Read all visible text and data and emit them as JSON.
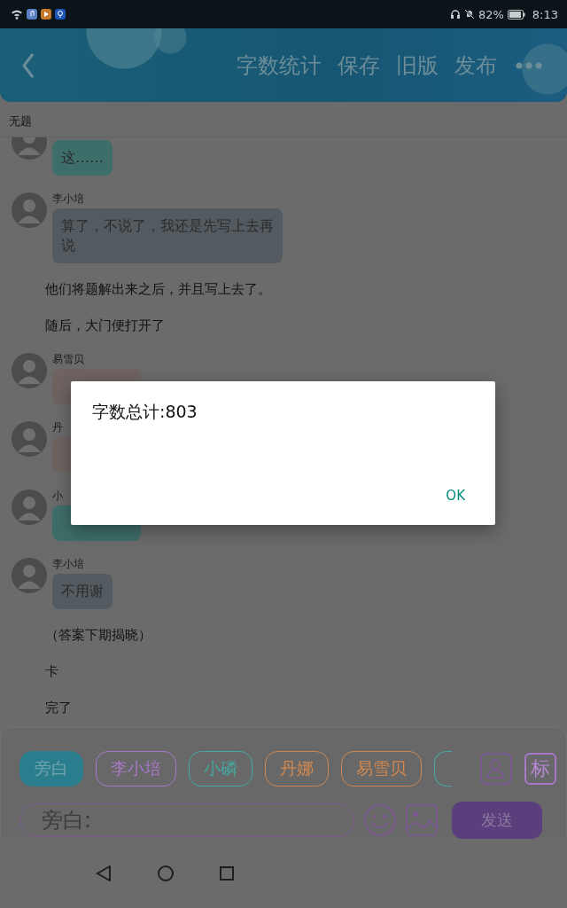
{
  "status_bar": {
    "battery_text": "82%",
    "time": "8:13"
  },
  "header": {
    "actions": [
      "字数统计",
      "保存",
      "旧版",
      "发布"
    ]
  },
  "title": "无题",
  "messages": [
    {
      "kind": "bubble",
      "cut_top": true,
      "text": "这……",
      "color": "#3e6e69"
    },
    {
      "kind": "bubble",
      "speaker": "李小培",
      "text": "算了，不说了，我还是先写上去再说",
      "color": "#545b60"
    },
    {
      "kind": "narration",
      "text": "他们将题解出来之后，并且写上去了。"
    },
    {
      "kind": "narration",
      "text": "随后，大门便打开了"
    },
    {
      "kind": "bubble",
      "speaker": "易雪贝",
      "color": "#6e6361"
    },
    {
      "kind": "bubble",
      "speaker": "丹",
      "color": "#6e6361"
    },
    {
      "kind": "bubble",
      "speaker": "小",
      "color": "#3e6e69"
    },
    {
      "kind": "bubble",
      "speaker": "李小培",
      "text": "不用谢",
      "color": "#545b60"
    },
    {
      "kind": "narration",
      "text": "（答案下期揭晓）"
    },
    {
      "kind": "narration",
      "text": "卡"
    },
    {
      "kind": "narration",
      "text": "完了"
    }
  ],
  "dialog": {
    "message": "字数总计:803",
    "button": "OK"
  },
  "input_panel": {
    "chips": [
      {
        "kind": "chip",
        "label": "旁白",
        "color": "#2a7d8c",
        "selected": true
      },
      {
        "kind": "chip",
        "label": "李小培",
        "color": "#a878c8",
        "selected": false
      },
      {
        "kind": "chip",
        "label": "小磷",
        "color": "#44a8a2",
        "selected": false
      },
      {
        "kind": "chip",
        "label": "丹娜",
        "color": "#d08850",
        "selected": false
      },
      {
        "kind": "chip",
        "label": "易雪贝",
        "color": "#d08850",
        "selected": false
      },
      {
        "kind": "partial",
        "color": "#44a8a2",
        "selected": false
      }
    ],
    "tag_button": "标",
    "placeholder": "旁白:",
    "send": "发送"
  }
}
